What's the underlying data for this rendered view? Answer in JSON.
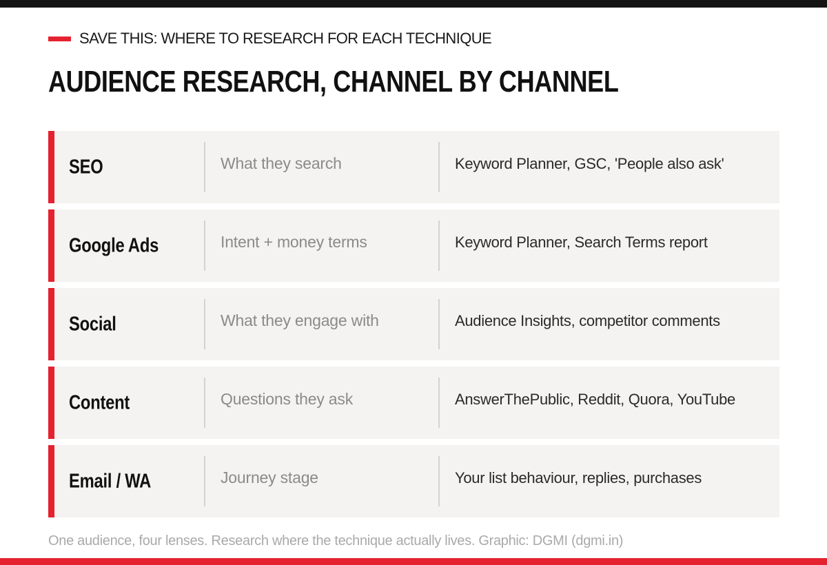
{
  "header": {
    "kicker": "SAVE THIS: WHERE TO RESEARCH FOR EACH TECHNIQUE",
    "title": "AUDIENCE RESEARCH, CHANNEL BY CHANNEL"
  },
  "rows": [
    {
      "channel": "SEO",
      "focus": "What they search",
      "tools": "Keyword Planner, GSC, 'People also ask'"
    },
    {
      "channel": "Google Ads",
      "focus": "Intent + money terms",
      "tools": "Keyword Planner, Search Terms report"
    },
    {
      "channel": "Social",
      "focus": "What they engage with",
      "tools": "Audience Insights, competitor comments"
    },
    {
      "channel": "Content",
      "focus": "Questions they ask",
      "tools": "AnswerThePublic, Reddit, Quora, YouTube"
    },
    {
      "channel": "Email / WA",
      "focus": "Journey stage",
      "tools": "Your list behaviour, replies, purchases"
    }
  ],
  "footer": {
    "text": "One audience, four lenses. Research where the technique actually lives. Graphic: DGMI (dgmi.in)"
  },
  "colors": {
    "accent": "#e42230",
    "top_bar": "#141414",
    "row_background": "#f4f3f1"
  }
}
